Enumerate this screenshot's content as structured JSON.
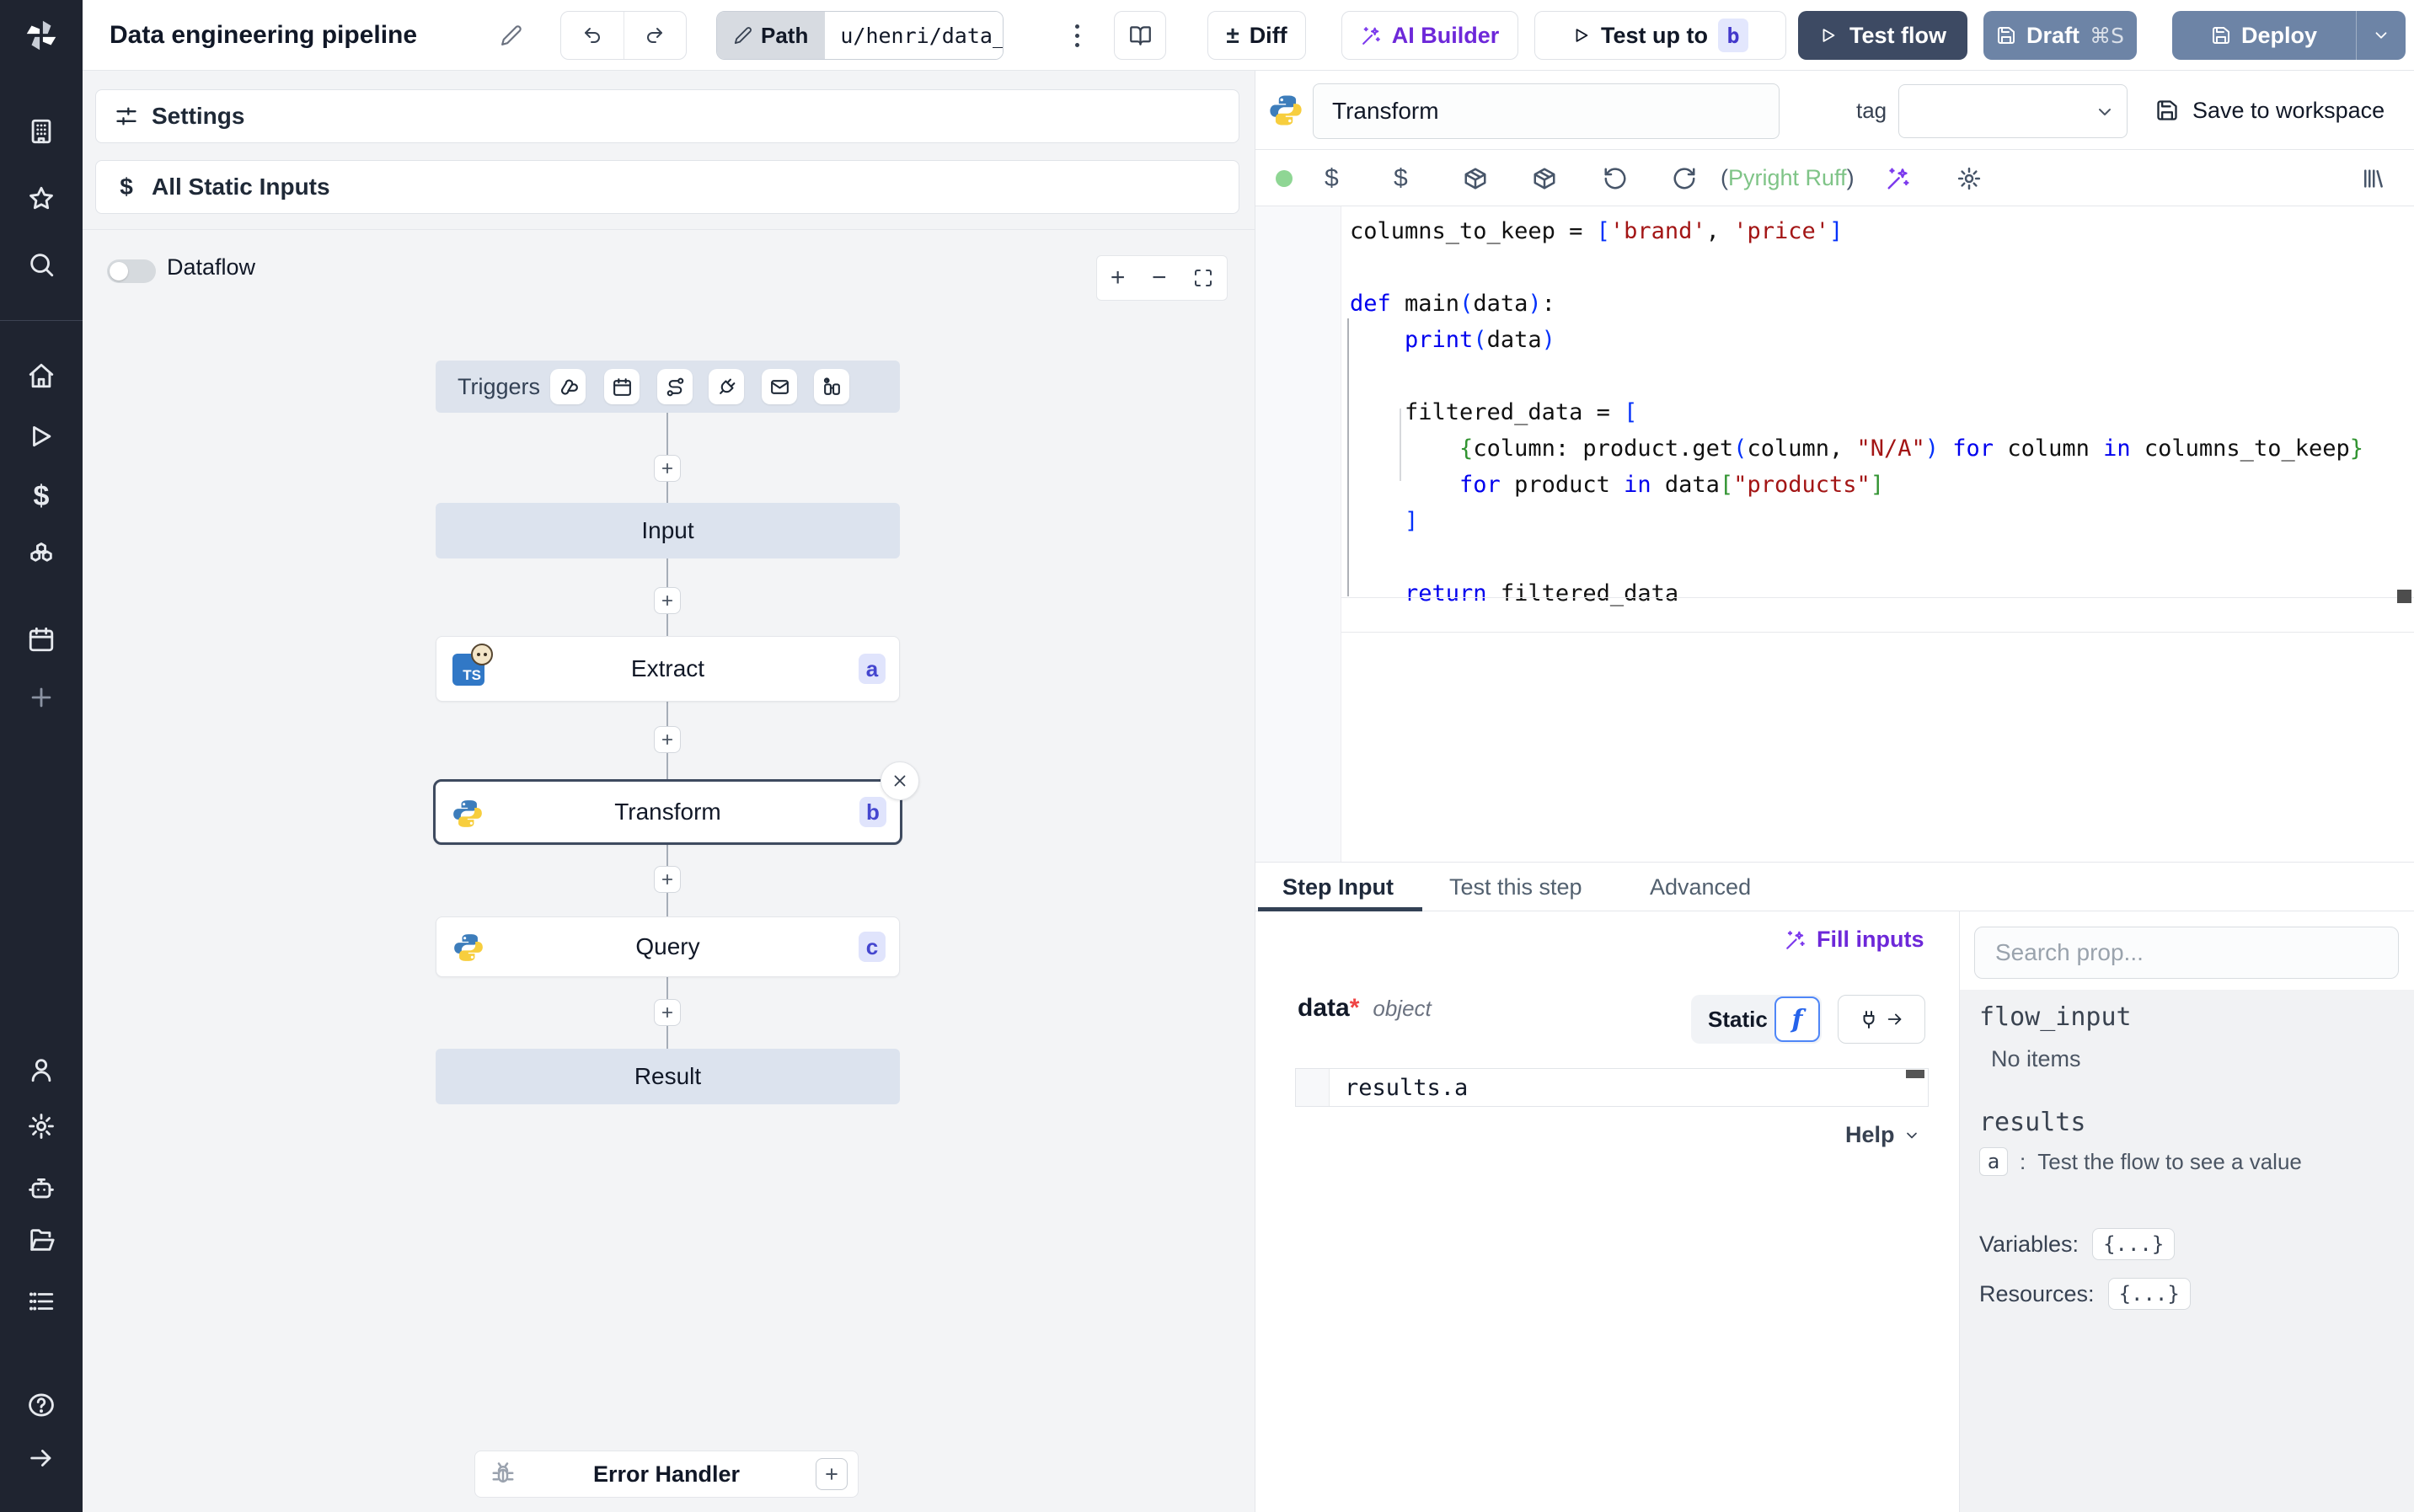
{
  "header": {
    "title": "Data engineering pipeline",
    "path": {
      "label": "Path",
      "value": "u/henri/data_"
    },
    "buttons": {
      "diff": "Diff",
      "ai_builder": "AI Builder",
      "test_up_to": "Test up to",
      "test_up_to_badge": "b",
      "test_flow": "Test flow",
      "draft": "Draft",
      "draft_shortcut": "⌘S",
      "deploy": "Deploy"
    }
  },
  "sidebar": {
    "icons": [
      "windmill-logo",
      "workspace-building",
      "favorites-star",
      "search",
      "home",
      "runs-play",
      "variables-dollar",
      "resources-cubes",
      "schedules-calendar",
      "add-plus",
      "user",
      "settings-gear",
      "ai-robot",
      "folders",
      "audit-logs-list",
      "help",
      "collapse-arrow"
    ]
  },
  "flow_panel": {
    "settings_label": "Settings",
    "static_inputs_label": "All Static Inputs",
    "dataflow_label": "Dataflow",
    "triggers_label": "Triggers",
    "trigger_icons": [
      "webhook",
      "schedule-calendar",
      "http-route",
      "websocket-plug",
      "email",
      "scheduled-poll"
    ],
    "nodes": {
      "input": {
        "label": "Input"
      },
      "extract": {
        "label": "Extract",
        "badge": "a",
        "language": "typescript"
      },
      "transform": {
        "label": "Transform",
        "badge": "b",
        "language": "python",
        "selected": true
      },
      "query": {
        "label": "Query",
        "badge": "c",
        "language": "python"
      },
      "result": {
        "label": "Result"
      },
      "error_handler": {
        "label": "Error Handler"
      }
    }
  },
  "step_editor": {
    "name": "Transform",
    "tag_label": "tag",
    "save_label": "Save to workspace",
    "lint_open": "(",
    "lint_text": "Pyright Ruff",
    "lint_close": ")",
    "code_lines": [
      [
        [
          "columns_to_keep = ",
          "p"
        ],
        [
          "[",
          "b"
        ],
        [
          "'brand'",
          "s"
        ],
        [
          ", ",
          "p"
        ],
        [
          "'price'",
          "s"
        ],
        [
          "]",
          "b"
        ]
      ],
      [],
      [
        [
          "def",
          "k"
        ],
        [
          " main",
          "p"
        ],
        [
          "(",
          "b"
        ],
        [
          "data",
          "p"
        ],
        [
          ")",
          "b"
        ],
        [
          ":",
          "p"
        ]
      ],
      [
        [
          "    ",
          "p"
        ],
        [
          "print",
          "k"
        ],
        [
          "(",
          "b"
        ],
        [
          "data",
          "p"
        ],
        [
          ")",
          "b"
        ]
      ],
      [],
      [
        [
          "    filtered_data = ",
          "p"
        ],
        [
          "[",
          "b"
        ]
      ],
      [
        [
          "        ",
          "p"
        ],
        [
          "{",
          "g"
        ],
        [
          "column: product.get",
          "p"
        ],
        [
          "(",
          "b"
        ],
        [
          "column, ",
          "p"
        ],
        [
          "\"N/A\"",
          "s"
        ],
        [
          ")",
          "b"
        ],
        [
          " ",
          "p"
        ],
        [
          "for",
          "k"
        ],
        [
          " column ",
          "p"
        ],
        [
          "in",
          "k"
        ],
        [
          " columns_to_keep",
          "p"
        ],
        [
          "}",
          "g"
        ]
      ],
      [
        [
          "        ",
          "p"
        ],
        [
          "for",
          "k"
        ],
        [
          " product ",
          "p"
        ],
        [
          "in",
          "k"
        ],
        [
          " data",
          "p"
        ],
        [
          "[",
          "g"
        ],
        [
          "\"products\"",
          "s"
        ],
        [
          "]",
          "g"
        ]
      ],
      [
        [
          "    ",
          "p"
        ],
        [
          "]",
          "b"
        ]
      ],
      [],
      [
        [
          "    ",
          "p"
        ],
        [
          "return",
          "k"
        ],
        [
          " filtered_data",
          "p"
        ]
      ]
    ]
  },
  "tabs": {
    "step_input": "Step Input",
    "test_this_step": "Test this step",
    "advanced": "Advanced",
    "active": "Step Input"
  },
  "step_input_panel": {
    "fill_inputs": "Fill inputs",
    "arg": {
      "name": "data",
      "required_mark": "*",
      "type": "object"
    },
    "static_label": "Static",
    "expression": "results.a",
    "help_label": "Help"
  },
  "props_panel": {
    "search_placeholder": "Search prop...",
    "flow_input_title": "flow_input",
    "flow_input_empty": "No items",
    "results_title": "results",
    "results": [
      {
        "key": "a",
        "hint": "Test the flow to see a value"
      }
    ],
    "variables_label": "Variables:",
    "variables_value": "{...}",
    "resources_label": "Resources:",
    "resources_value": "{...}"
  },
  "colors": {
    "accent_purple": "#6d28d9",
    "test_flow_bg": "#3d4a63",
    "deploy_bg": "#6d84a6",
    "node_badge_bg": "#e0e4fc",
    "node_badge_text": "#4446cf",
    "status_green": "#8fd694",
    "lint_green": "#7fc487",
    "python_blue": "#3d7dbb",
    "python_yellow": "#f7ce3e",
    "typescript_blue": "#3178c6",
    "sidebar_bg": "#1f2430",
    "canvas_bg": "#f3f4f6",
    "triggers_bar_bg": "#dde3ed",
    "code_keyword": "#0000ee",
    "code_string": "#a31515"
  }
}
